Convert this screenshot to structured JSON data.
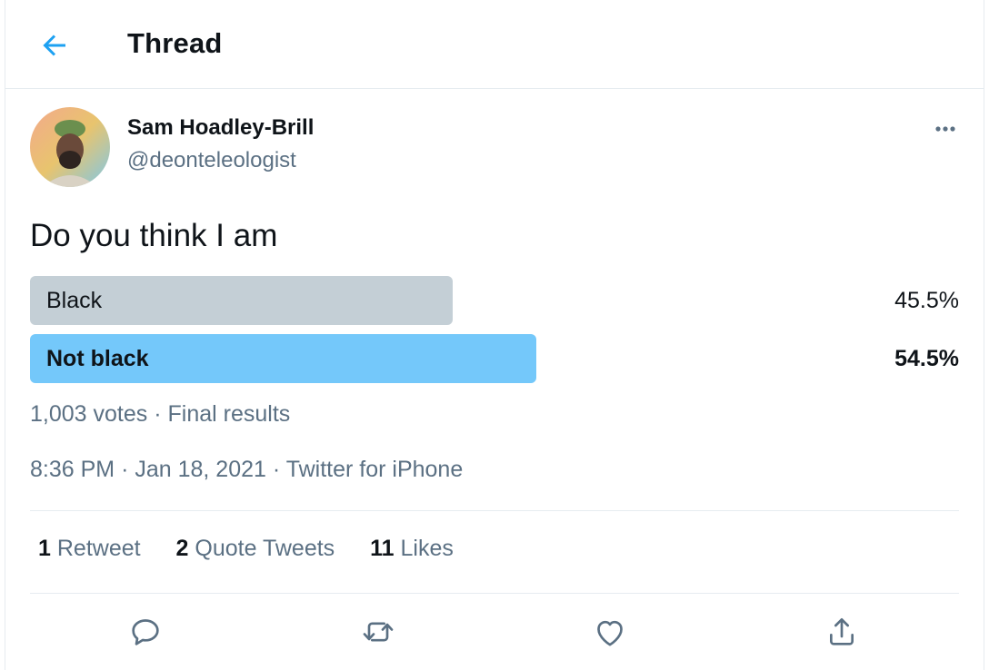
{
  "header": {
    "title": "Thread",
    "back_icon": "arrow-left-icon"
  },
  "tweet": {
    "author": {
      "name": "Sam Hoadley-Brill",
      "handle": "@deonteleologist"
    },
    "text": "Do you think I am",
    "poll": {
      "options": [
        {
          "label": "Black",
          "percent_text": "45.5%",
          "percent": 45.5,
          "winner": false
        },
        {
          "label": "Not black",
          "percent_text": "54.5%",
          "percent": 54.5,
          "winner": true
        }
      ],
      "votes": "1,003 votes",
      "separator": "·",
      "status": "Final results"
    },
    "time": "8:36 PM",
    "date": "Jan 18, 2021",
    "source": "Twitter for iPhone",
    "stats": {
      "retweets": {
        "count": "1",
        "label": "Retweet"
      },
      "quotes": {
        "count": "2",
        "label": "Quote Tweets"
      },
      "likes": {
        "count": "11",
        "label": "Likes"
      }
    }
  },
  "actions": [
    "reply-icon",
    "retweet-icon",
    "like-icon",
    "share-icon"
  ],
  "colors": {
    "accent": "#1da1f2",
    "poll_winner": "#74c8fa",
    "poll_loser": "#c4cfd6",
    "secondary_text": "#5b7083",
    "divider": "#e6ecf0"
  }
}
